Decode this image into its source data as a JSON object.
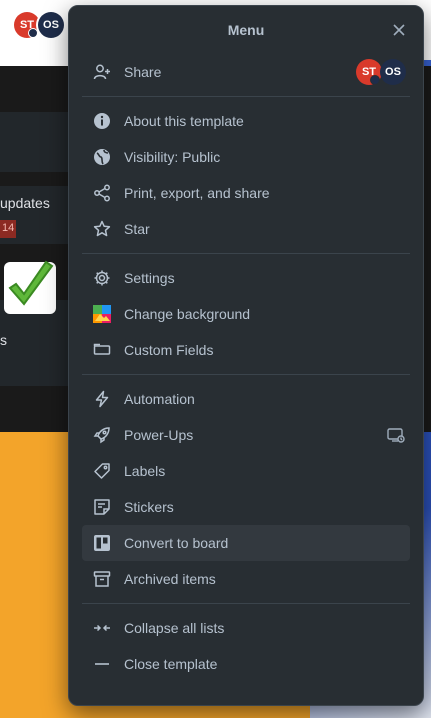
{
  "background": {
    "avatars": [
      "ST",
      "OS"
    ],
    "card_text_1": "updates",
    "card_badge": "14",
    "card_text_3": "s"
  },
  "menu": {
    "title": "Menu",
    "share": {
      "label": "Share",
      "avatars": [
        "ST",
        "OS"
      ]
    },
    "group1": [
      {
        "label": "About this template",
        "icon": "info-icon"
      },
      {
        "label": "Visibility: Public",
        "icon": "globe-icon"
      },
      {
        "label": "Print, export, and share",
        "icon": "share-nodes-icon"
      },
      {
        "label": "Star",
        "icon": "star-icon"
      }
    ],
    "group2": [
      {
        "label": "Settings",
        "icon": "gear-icon"
      },
      {
        "label": "Change background",
        "icon": "background-icon"
      },
      {
        "label": "Custom Fields",
        "icon": "custom-fields-icon"
      }
    ],
    "group3": [
      {
        "label": "Automation",
        "icon": "lightning-icon"
      },
      {
        "label": "Power-Ups",
        "icon": "rocket-icon"
      },
      {
        "label": "Labels",
        "icon": "tag-icon"
      },
      {
        "label": "Stickers",
        "icon": "sticker-icon"
      },
      {
        "label": "Convert to board",
        "icon": "board-icon"
      },
      {
        "label": "Archived items",
        "icon": "archive-icon"
      }
    ],
    "group4": [
      {
        "label": "Collapse all lists",
        "icon": "collapse-icon"
      },
      {
        "label": "Close template",
        "icon": "minus-icon"
      }
    ]
  },
  "colors": {
    "panel": "#282e33",
    "text": "#b6c2cf",
    "hover": "#33393f",
    "avatar_red": "#d93a2b",
    "avatar_navy": "#1f2d4a"
  }
}
